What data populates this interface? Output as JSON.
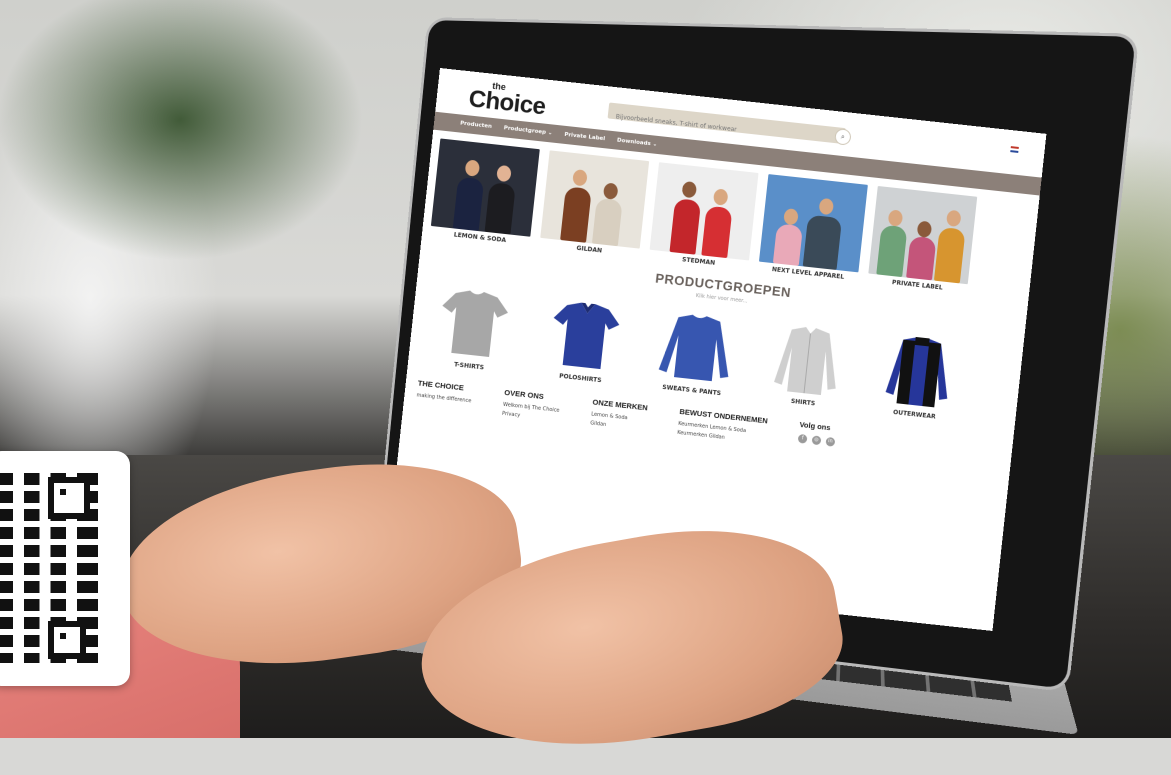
{
  "site": {
    "logo_small": "the",
    "logo_main": "Choice",
    "search_placeholder": "Bijvoorbeeld sneaks, T-shirt of workwear",
    "search_icon": "search-icon",
    "flag_icon": "dutch-flag-icon",
    "nav": [
      "Producten",
      "Productgroep ⌄",
      "Private Label",
      "Downloads ⌄"
    ]
  },
  "brands": [
    {
      "label": "LEMON & SODA",
      "bg": "#2b2f3a",
      "colors": [
        "#1b2340",
        "#1c1c20"
      ]
    },
    {
      "label": "GILDAN",
      "bg": "#e8e4dc",
      "colors": [
        "#7b3f22",
        "#d8cfc0"
      ]
    },
    {
      "label": "STEDMAN",
      "bg": "#eeeeee",
      "colors": [
        "#c3262b",
        "#d62f33"
      ]
    },
    {
      "label": "NEXT LEVEL APPAREL",
      "bg": "#5a8fc9",
      "colors": [
        "#e9a9b8",
        "#3a4a58"
      ]
    },
    {
      "label": "PRIVATE LABEL",
      "bg": "#cfd2d4",
      "colors": [
        "#6ea278",
        "#d7952f"
      ]
    }
  ],
  "section": {
    "title": "PRODUCTGROEPEN",
    "subtitle": "Klik hier voor meer..."
  },
  "products": [
    {
      "label": "T-SHIRTS",
      "color": "#a7a7a7"
    },
    {
      "label": "POLOSHIRTS",
      "color": "#2a3f9c"
    },
    {
      "label": "SWEATS & PANTS",
      "color": "#3756b0"
    },
    {
      "label": "SHIRTS",
      "color": "#cfcfcf"
    },
    {
      "label": "OUTERWEAR",
      "color": "#26369a"
    }
  ],
  "footer": {
    "col1_title": "THE CHOICE",
    "col1_items": [
      "making the difference"
    ],
    "col2_title": "OVER ONS",
    "col2_items": [
      "Welkom bij The Choice",
      "Privacy"
    ],
    "col3_title": "ONZE MERKEN",
    "col3_items": [
      "Lemon & Soda",
      "Gildan"
    ],
    "col4_title": "BEWUST ONDERNEMEN",
    "col4_items": [
      "Keurmerken Lemon & Soda",
      "Keurmerken Gildan"
    ],
    "col5_title": "Volg ons",
    "social_icons": [
      "facebook-icon",
      "instagram-icon",
      "linkedin-icon"
    ]
  },
  "colors": {
    "nav_bg": "#8c8079",
    "search_bg": "#ddd6c8",
    "sleeve": "#e07a75"
  }
}
